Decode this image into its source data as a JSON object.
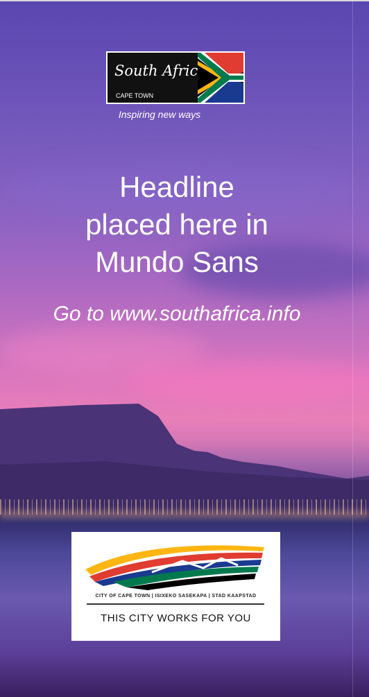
{
  "brand_logo": {
    "title": "South Africa",
    "subtitle": "CAPE TOWN"
  },
  "tagline": "Inspiring new ways",
  "headline": {
    "line1": "Headline",
    "line2": "placed here in",
    "line3": "Mundo Sans"
  },
  "url": "Go to www.southafrica.info",
  "city_logo": {
    "names": "CITY OF CAPE TOWN | ISIXEKO SASEKAPA | STAD KAAPSTAD",
    "slogan": "THIS CITY WORKS FOR YOU"
  },
  "colors": {
    "flag_red": "#e03c31",
    "flag_blue": "#1a3a8f",
    "flag_green": "#007a4d",
    "flag_yellow": "#ffb612",
    "flag_black": "#000000"
  }
}
